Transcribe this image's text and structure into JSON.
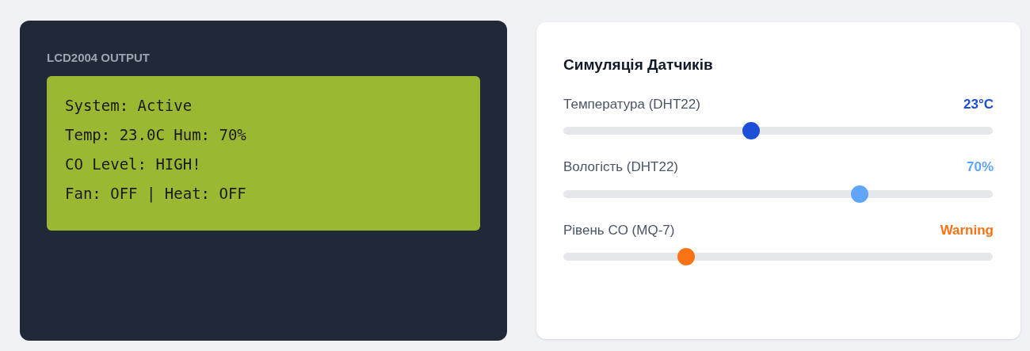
{
  "lcd": {
    "title": "LCD2004 OUTPUT",
    "lines": [
      "System: Active",
      "Temp: 23.0C Hum: 70%",
      "CO Level: HIGH!",
      "Fan: OFF | Heat: OFF"
    ]
  },
  "simulation": {
    "title": "Симуляція Датчиків",
    "sensors": [
      {
        "label": "Температура (DHT22)",
        "reading": "23°C",
        "level": 0.437,
        "color": "#1d4ed8"
      },
      {
        "label": "Вологість (DHT22)",
        "reading": "70%",
        "level": 0.69,
        "color": "#60a5fa"
      },
      {
        "label": "Рівень CO (MQ-7)",
        "reading": "Warning",
        "level": 0.286,
        "color": "#f97316"
      }
    ]
  }
}
